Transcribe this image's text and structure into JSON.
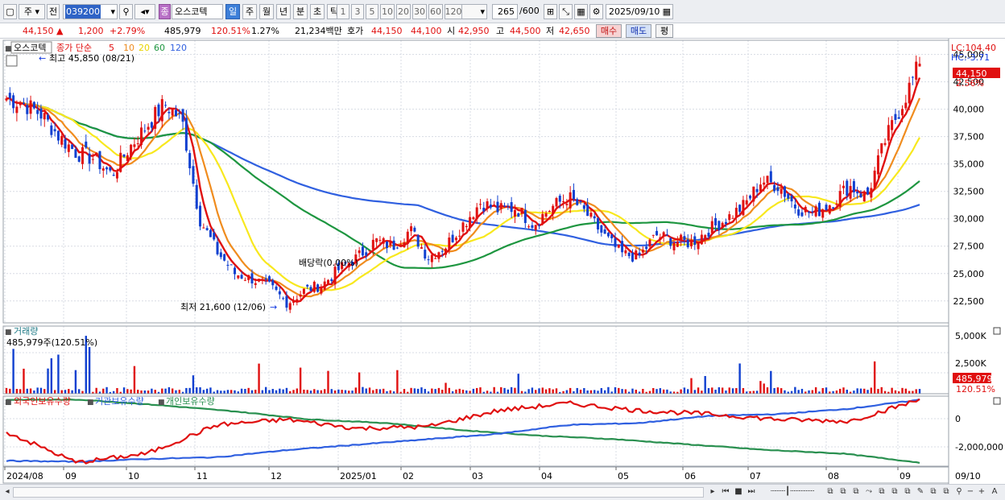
{
  "toolbar": {
    "mode": "주",
    "prev": "전",
    "code": "039200",
    "stock_badge": "종",
    "stock_name": "오스코텍",
    "periods": [
      "일",
      "주",
      "월",
      "년",
      "분",
      "초",
      "틱"
    ],
    "active_period": "일",
    "intervals": [
      "1",
      "3",
      "5",
      "10",
      "20",
      "30",
      "60",
      "120"
    ],
    "count": "265",
    "count_max": "600",
    "date": "2025/09/10"
  },
  "quote": {
    "price": "44,150",
    "change": "1,200",
    "change_arrow": "▲",
    "change_pct": "+2.79%",
    "volume": "485,979",
    "volume_ratio": "120.51%",
    "turnover_pct": "1.27%",
    "amount": "21,234백만",
    "quote_label": "호가",
    "ask": "44,150",
    "bid": "44,100",
    "open_label": "시",
    "open": "42,950",
    "high_label": "고",
    "high": "44,500",
    "low_label": "저",
    "low": "42,650",
    "buy_label": "매수",
    "sell_label": "매도",
    "eval_label": "평"
  },
  "price_panel": {
    "stock_name": "오스코텍",
    "ma_label": "종가 단순",
    "ma_periods": [
      "5",
      "10",
      "20",
      "60",
      "120"
    ],
    "high_note": "최고 45,850 (08/21)",
    "low_note": "최저 21,600 (12/06)",
    "dividend_note": "배당락(0.00%)",
    "lc_label": "LC:104.40",
    "hc_label": "HC:-3.71",
    "last_price": "44,150",
    "last_pct": "2.56%",
    "y_ticks": [
      "45,000",
      "42,500",
      "40,000",
      "37,500",
      "35,000",
      "32,500",
      "30,000",
      "27,500",
      "25,000",
      "22,500"
    ]
  },
  "volume_panel": {
    "title": "거래량",
    "value_note": "485,979주(120.51%)",
    "y_ticks": [
      "5,000K",
      "2,500K"
    ],
    "last_value": "485,979",
    "last_pct": "120.51%"
  },
  "holding_panel": {
    "series_labels": [
      "외국인보유수량",
      "기관보유수량",
      "개인보유수량"
    ],
    "y_ticks": [
      "0",
      "-2,000,000"
    ]
  },
  "x_axis": {
    "labels": [
      "2024/08",
      "09",
      "10",
      "11",
      "12",
      "2025/01",
      "02",
      "03",
      "04",
      "05",
      "06",
      "07",
      "08",
      "09"
    ],
    "last_label": "09/10"
  },
  "colors": {
    "candle_up": "#e01010",
    "candle_down": "#1040d0",
    "ma5": "#e01010",
    "ma10": "#f08c1e",
    "ma20": "#f8e81e",
    "ma60": "#1e9640",
    "ma120": "#3060e0",
    "foreign": "#e01010",
    "institution": "#3060e0",
    "individual": "#2a9050"
  },
  "chart_data": {
    "type": "candlestick",
    "title": "오스코텍",
    "x": [
      "2024/08",
      "09",
      "10",
      "11",
      "12",
      "2025/01",
      "02",
      "03",
      "04",
      "05",
      "06",
      "07",
      "08",
      "09"
    ],
    "close_series": [
      41000,
      40500,
      39500,
      37500,
      36000,
      35500,
      34000,
      36500,
      38500,
      40500,
      39000,
      30000,
      27000,
      25000,
      24500,
      23800,
      22300,
      23500,
      24000,
      25500,
      26500,
      28000,
      27500,
      29000,
      26500,
      27500,
      29500,
      31500,
      30800,
      31000,
      29500,
      31000,
      32000,
      30500,
      28500,
      26800,
      26500,
      28500,
      28000,
      27800,
      29000,
      30000,
      31200,
      33500,
      33000,
      31000,
      30500,
      31500,
      33000,
      32000,
      37000,
      40500,
      44150
    ],
    "ylim": [
      20500,
      46000
    ],
    "volume_ylim": [
      0,
      6000000
    ],
    "holding_ylim": [
      -2900000,
      1000000
    ],
    "moving_averages": [
      "5",
      "10",
      "20",
      "60",
      "120"
    ]
  }
}
